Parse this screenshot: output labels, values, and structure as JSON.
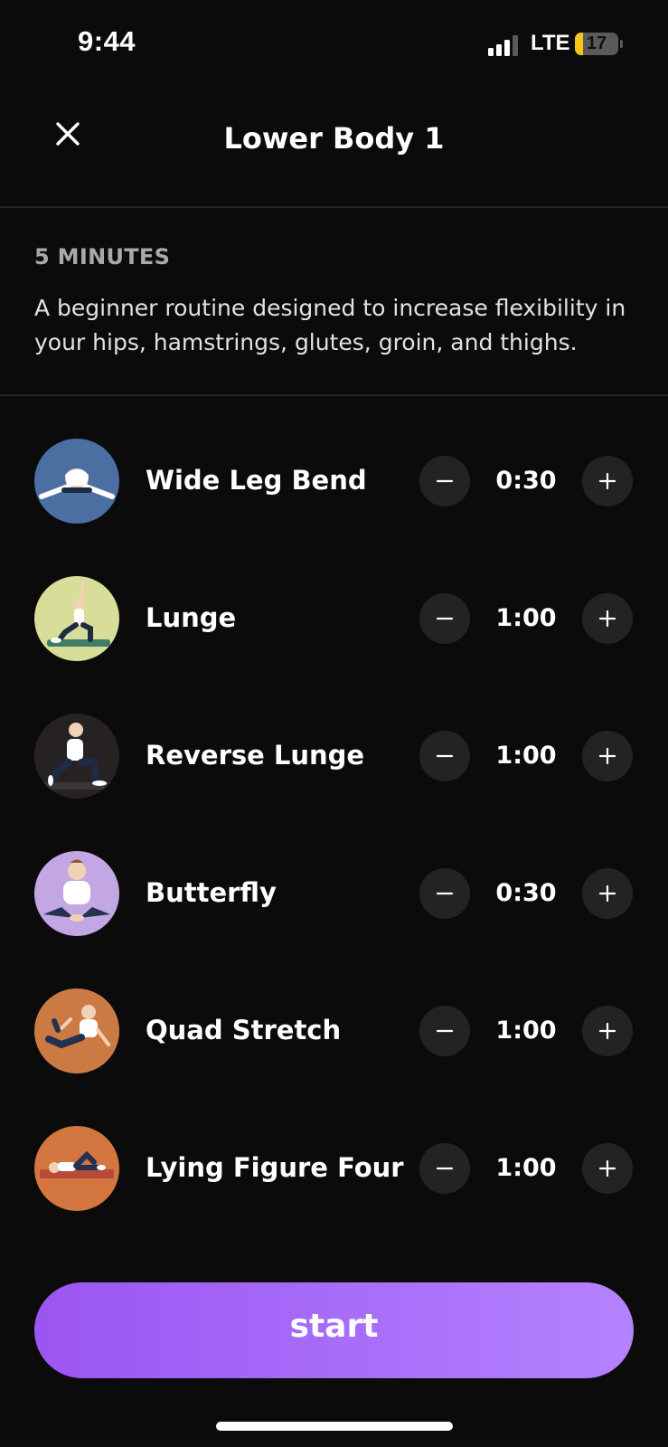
{
  "status_bar": {
    "time": "9:44",
    "network": "LTE",
    "battery": "17",
    "battery_level": 0.17
  },
  "header": {
    "title": "Lower Body 1",
    "close_icon": "close-icon"
  },
  "info": {
    "duration": "5 MINUTES",
    "description": "A beginner routine designed to increase flexibility in your hips, hamstrings, glutes, groin, and thighs."
  },
  "exercises": [
    {
      "name": "Wide Leg Bend",
      "time": "0:30",
      "thumb_color": "#4a6fa0"
    },
    {
      "name": "Lunge",
      "time": "1:00",
      "thumb_color": "#d9dd9a"
    },
    {
      "name": "Reverse Lunge",
      "time": "1:00",
      "thumb_color": "#262223"
    },
    {
      "name": "Butterfly",
      "time": "0:30",
      "thumb_color": "#c3a6e4"
    },
    {
      "name": "Quad Stretch",
      "time": "1:00",
      "thumb_color": "#cc7a44"
    },
    {
      "name": "Lying Figure Four",
      "time": "1:00",
      "thumb_color": "#d4763f"
    }
  ],
  "start_button": {
    "label": "start"
  },
  "colors": {
    "background": "#0b0b0b",
    "accent_start": "#9b55f2",
    "accent_end": "#b582ff",
    "stepper_bg": "#232323"
  }
}
